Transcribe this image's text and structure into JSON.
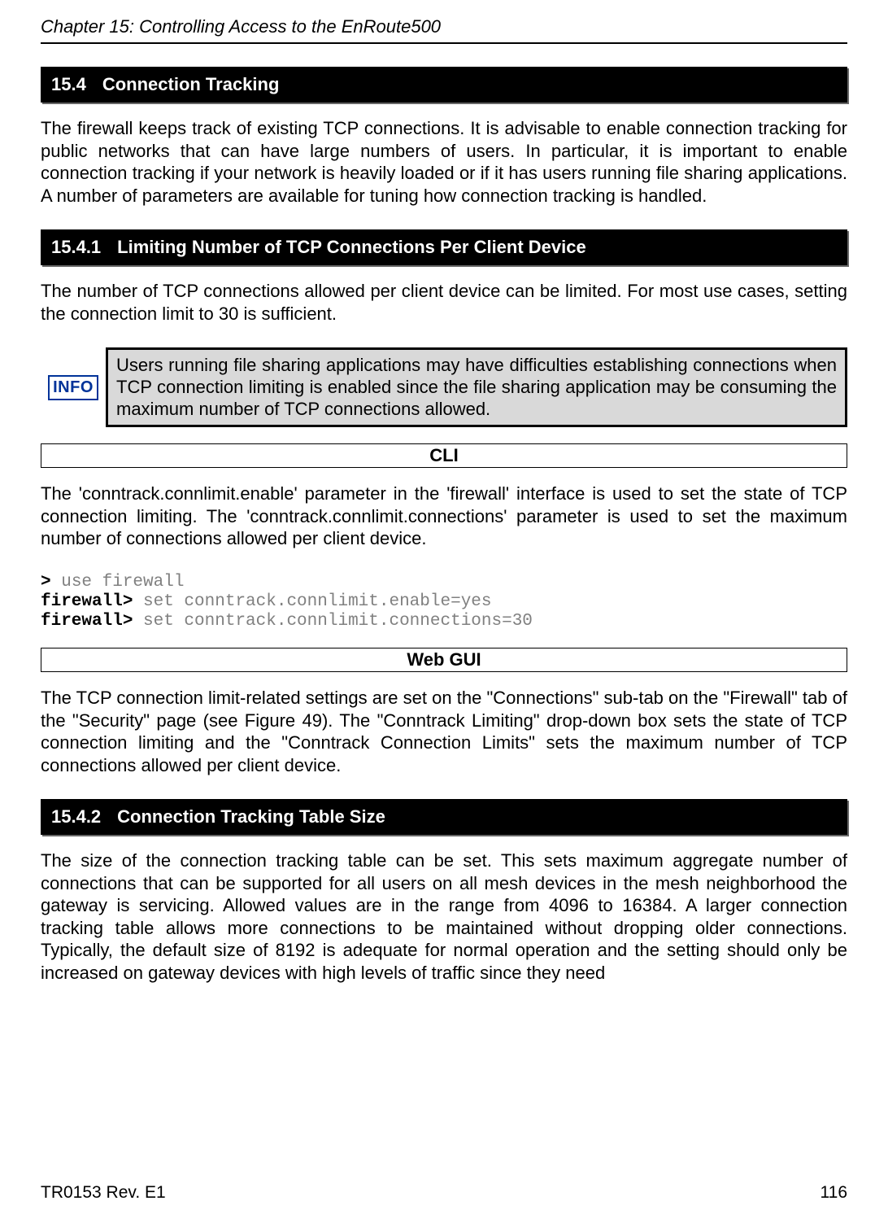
{
  "header": {
    "chapter": "Chapter 15: Controlling Access to the EnRoute500"
  },
  "sections": {
    "s1": {
      "num": "15.4",
      "title": "Connection Tracking"
    },
    "s2": {
      "num": "15.4.1",
      "title": "Limiting Number of TCP Connections Per Client Device"
    },
    "s3": {
      "num": "15.4.2",
      "title": "Connection Tracking Table Size"
    }
  },
  "paragraphs": {
    "p1": "The firewall keeps track of existing TCP connections. It is advisable to enable connection tracking for public networks that can have large numbers of users. In particular, it is important to enable connection tracking if your network is heavily loaded or if it has users running file sharing applications. A number of parameters are available for tuning how connection tracking is handled.",
    "p2": "The number of TCP connections allowed per client device can be limited. For most use cases, setting the connection limit to 30 is sufficient.",
    "p3": "The 'conntrack.connlimit.enable' parameter in the 'firewall' interface is used to set the state of TCP connection limiting. The 'conntrack.connlimit.connections' parameter is used to set the maximum number of connections allowed per client device.",
    "p4": "The TCP connection limit-related settings are set on the \"Connections\" sub-tab on the \"Firewall\" tab of the \"Security\" page (see Figure 49). The \"Conntrack Limiting\" drop-down box sets the state of TCP connection limiting and the \"Conntrack Connection Limits\" sets the maximum number of TCP connections allowed per client device.",
    "p5": "The size of the connection tracking table can be set. This sets maximum aggregate number of connections that can be supported for all users on all mesh devices in the mesh neighborhood the gateway is servicing. Allowed values are in the range from 4096 to 16384. A larger connection tracking table allows more connections to be maintained without dropping older connections. Typically, the default size of 8192 is adequate for normal operation and the setting should only be increased on gateway devices with high levels of traffic since they need"
  },
  "info": {
    "badge": "INFO",
    "text": "Users running file sharing applications may have difficulties establishing connections when TCP connection limiting is enabled since the file sharing application may be consuming the maximum number of TCP connections allowed."
  },
  "labels": {
    "cli": "CLI",
    "webgui": "Web GUI"
  },
  "code": {
    "l1p": ">",
    "l1c": " use firewall",
    "l2p": "firewall>",
    "l2c": " set conntrack.connlimit.enable=yes",
    "l3p": "firewall>",
    "l3c": " set conntrack.connlimit.connections=30"
  },
  "footer": {
    "left": "TR0153 Rev. E1",
    "right": "116"
  }
}
